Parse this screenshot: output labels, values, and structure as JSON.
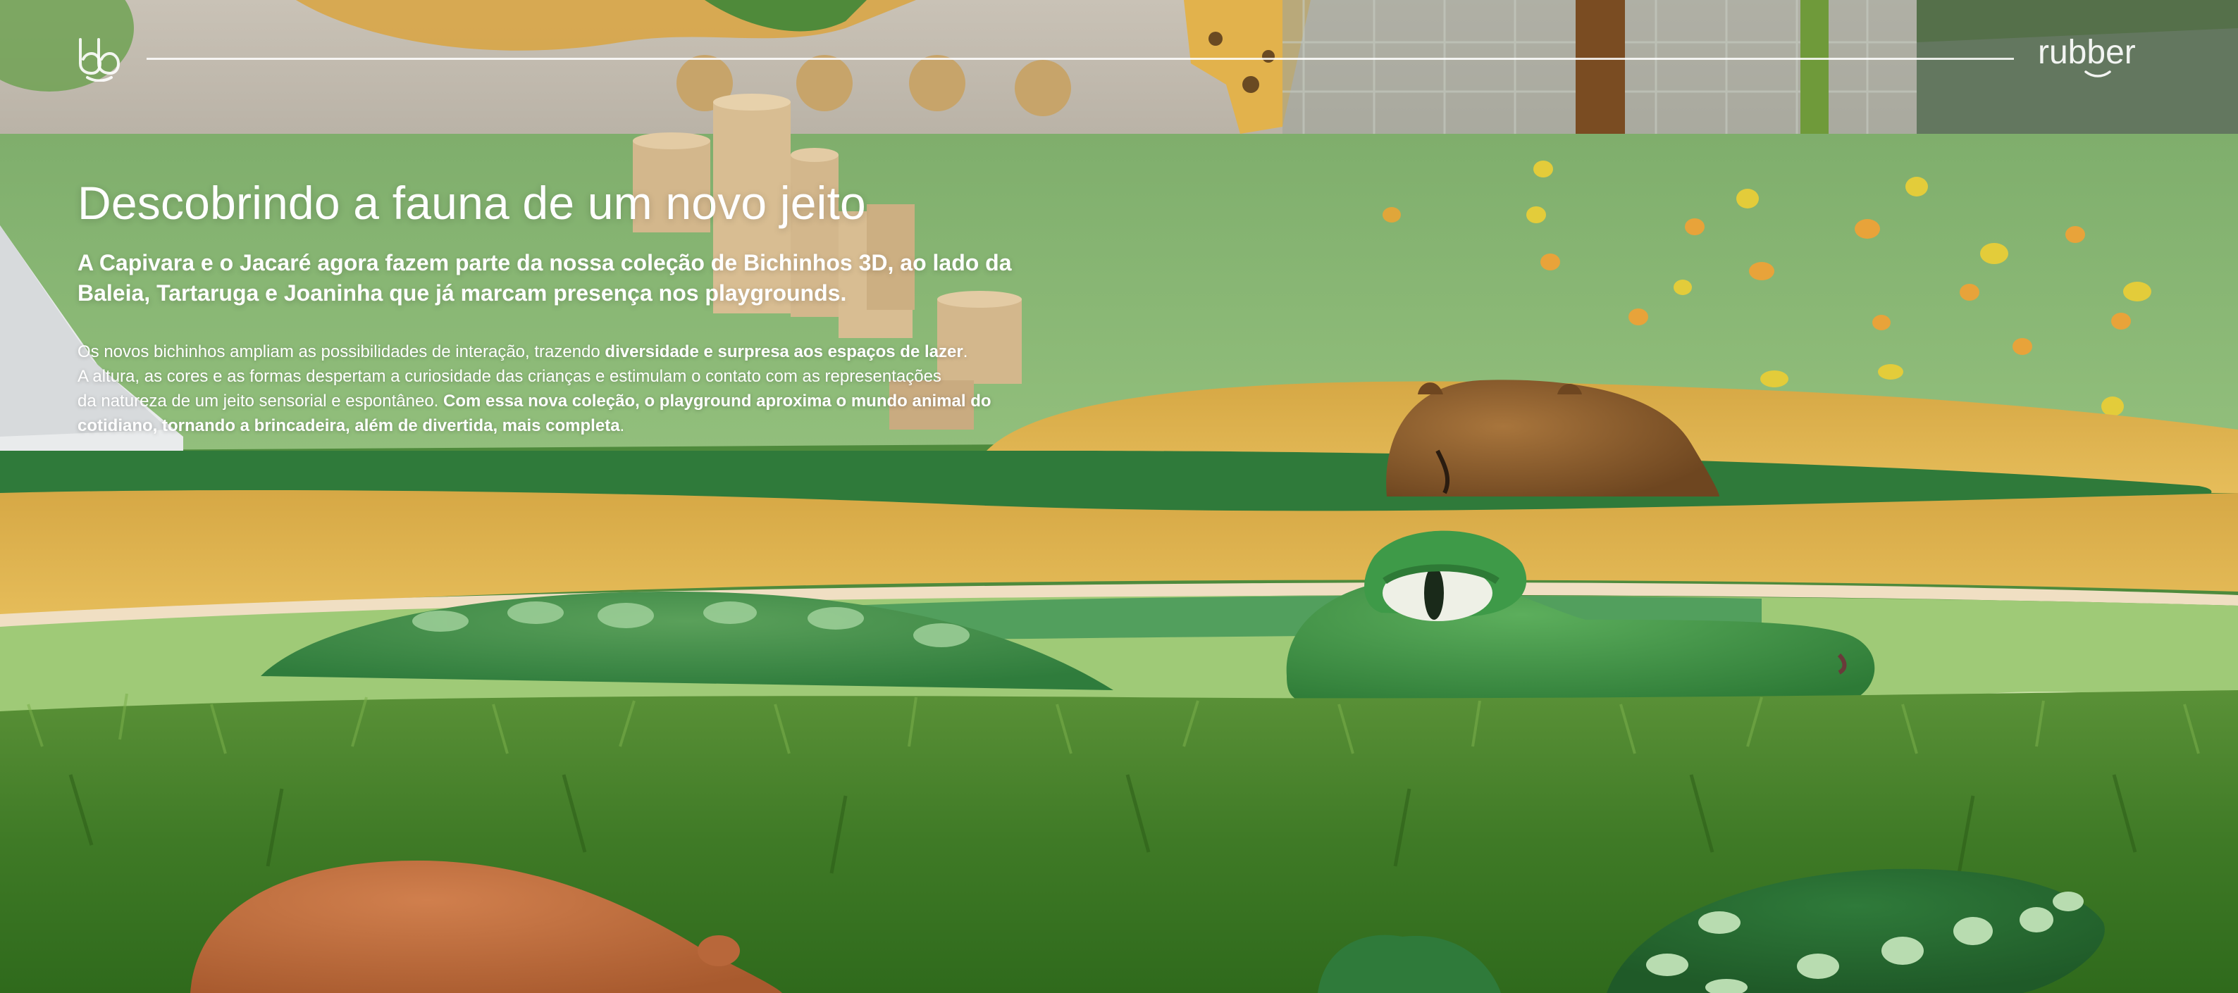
{
  "header": {
    "logo_left": "bb",
    "logo_right": "rubber",
    "icons": [
      "bb-logo-icon",
      "rubber-logo-icon"
    ]
  },
  "hero": {
    "title": "Descobrindo a fauna de um novo jeito",
    "subtitle_line1": "A Capivara e o Jacaré agora fazem parte da nossa coleção de Bichinhos 3D, ao lado da",
    "subtitle_line2": "Baleia, Tartaruga e Joaninha que já marcam presença nos playgrounds.",
    "body_1": "Os novos bichinhos ampliam as possibilidades de interação, trazendo ",
    "body_1_bold": "diversidade e surpresa aos espaços de lazer",
    "body_1_end": ".",
    "body_2": "A altura, as cores e as formas despertam a curiosidade das crianças e estimulam o contato com as representações",
    "body_3": "da natureza de um jeito sensorial e espontâneo. ",
    "body_3_bold": "Com essa nova coleção, o playground aproxima o mundo animal do",
    "body_4_bold": "cotidiano, tornando a brincadeira, além de divertida, mais completa",
    "body_4_end": "."
  },
  "colors": {
    "grass": "#4f8a34",
    "rubber_green": "#8cbb78",
    "rubber_yellow": "#e4b74e",
    "dark_green": "#2f7a3a",
    "capybara": "#8a5a2a",
    "croc": "#3f8f45",
    "text": "#ffffff"
  }
}
